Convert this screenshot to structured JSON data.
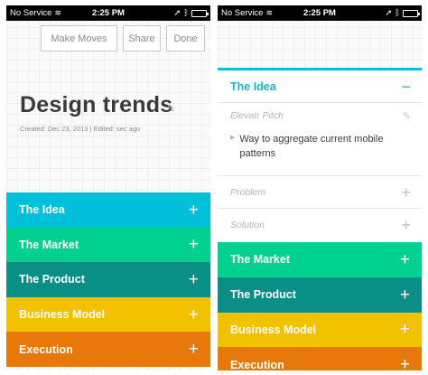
{
  "status": {
    "carrier": "No Service",
    "time": "2:25 PM"
  },
  "left": {
    "buttons": {
      "make_moves": "Make Moves",
      "share": "Share",
      "done": "Done"
    },
    "title": "Design trends",
    "meta": "Created: Dec 23, 2013 | Edited: sec ago",
    "sections": [
      {
        "label": "The Idea",
        "color": "#00c0da"
      },
      {
        "label": "The Market",
        "color": "#00d18f"
      },
      {
        "label": "The Product",
        "color": "#0a8f86"
      },
      {
        "label": "Business Model",
        "color": "#f2c100"
      },
      {
        "label": "Execution",
        "color": "#e8780a"
      }
    ]
  },
  "right": {
    "expanded_section": "The Idea",
    "pitch_label": "Elevatr Pitch",
    "pitch_text": "Way to aggregate current mobile patterns",
    "subsections": [
      "Problem",
      "Solution"
    ],
    "sections": [
      {
        "label": "The Market",
        "color": "#00d18f"
      },
      {
        "label": "The Product",
        "color": "#0a8f86"
      },
      {
        "label": "Business Model",
        "color": "#f2c100"
      },
      {
        "label": "Execution",
        "color": "#e8780a"
      }
    ]
  },
  "icons": {
    "plus": "+",
    "minus": "−",
    "edit": "✎",
    "wifi": "≋",
    "location": "➚",
    "bluetooth": "ᛒ",
    "chevron": "▶"
  }
}
